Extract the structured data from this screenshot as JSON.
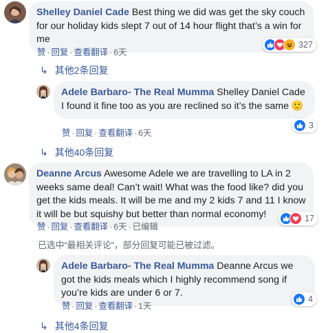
{
  "comments": [
    {
      "author": "Shelley Daniel Cade",
      "text": "Best thing we did was get the sky couch for our holiday kids slept 7 out of 14 hour flight that’s a win for me",
      "actions": {
        "like": "赞",
        "reply": "回复",
        "translate": "查看翻译",
        "time": "6天"
      },
      "reaction_count": "327",
      "reaction_icons": [
        "like-reaction-icon",
        "love-reaction-icon",
        "haha-reaction-icon"
      ]
    },
    {
      "author": "Adele Barbaro- The Real Mumma",
      "text_line1": "Shelley Daniel Cade",
      "text_rest": "I found it fine too as you are reclined so it’s the same",
      "emoji": "🙂",
      "actions": {
        "like": "赞",
        "reply": "回复",
        "translate": "查看翻译",
        "time": "6天"
      },
      "reaction_count": "3",
      "reaction_icons": [
        "like-reaction-icon"
      ]
    },
    {
      "author": "Deanne Arcus",
      "text": "Awesome Adele we are travelling to LA in 2 weeks same deal! Can’t wait! What was the food like? did you get the kids meals. It will be me and my 2 kids 7 and 11 I know it will be but squishy but better than normal economy!",
      "actions": {
        "like": "赞",
        "reply": "回复",
        "translate": "查看翻译",
        "time": "6天",
        "edited": "已编辑"
      },
      "reaction_count": "17",
      "reaction_icons": [
        "like-reaction-icon",
        "love-reaction-icon"
      ]
    },
    {
      "author": "Adele Barbaro- The Real Mumma",
      "text": "Deanne Arcus we got the kids meals which I highly recommend song if you’re kids are under 6 or 7.",
      "actions": {
        "like": "赞",
        "reply": "回复",
        "translate": "查看翻译",
        "time": "1天"
      },
      "reaction_count": "4",
      "reaction_icons": [
        "like-reaction-icon"
      ]
    }
  ],
  "more_replies": [
    "其他2条回复",
    "其他40条回复",
    "其他4条回复"
  ],
  "filter_notice": "已选中“最相关评论”，部分回复可能已被过滤。",
  "colors": {
    "link": "#385898",
    "meta": "#606770",
    "bubble": "#f2f3f5",
    "like": "#1877f2",
    "love": "#f33e58",
    "haha": "#f7b125"
  }
}
